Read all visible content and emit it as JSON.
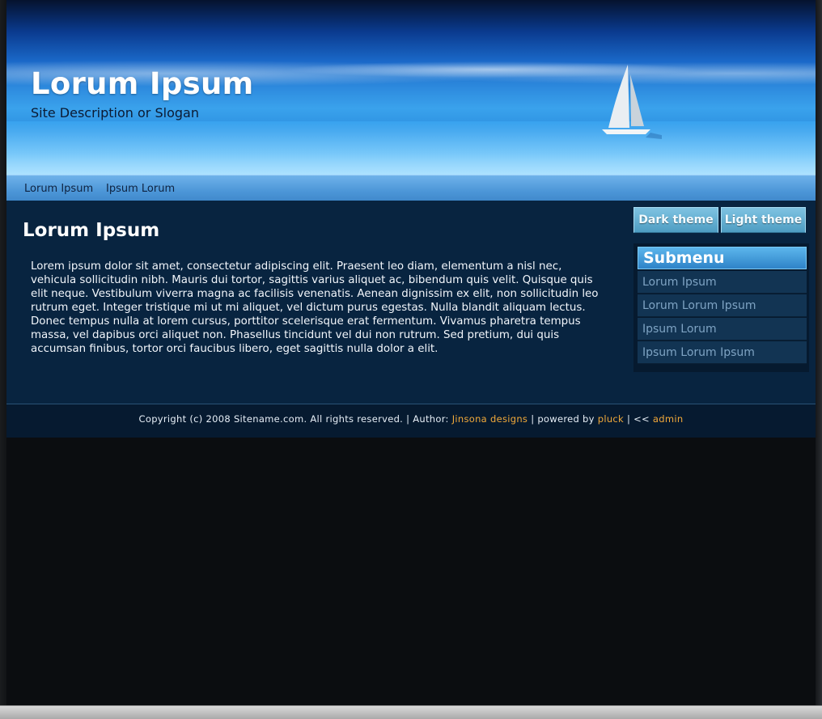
{
  "header": {
    "title": "Lorum Ipsum",
    "slogan": "Site Description or Slogan"
  },
  "nav": {
    "items": [
      "Lorum Ipsum",
      "Ipsum Lorum"
    ]
  },
  "main": {
    "title": "Lorum Ipsum",
    "body": "Lorem ipsum dolor sit amet, consectetur adipiscing elit. Praesent leo diam, elementum a nisl nec, vehicula sollicitudin nibh. Mauris dui tortor, sagittis varius aliquet ac, bibendum quis velit. Quisque quis elit neque. Vestibulum viverra magna ac facilisis venenatis. Aenean dignissim ex elit, non sollicitudin leo rutrum eget. Integer tristique mi ut mi aliquet, vel dictum purus egestas. Nulla blandit aliquam lectus. Donec tempus nulla at lorem cursus, porttitor scelerisque erat fermentum. Vivamus pharetra tempus massa, vel dapibus orci aliquet non. Phasellus tincidunt vel dui non rutrum. Sed pretium, dui quis accumsan finibus, tortor orci faucibus libero, eget sagittis nulla dolor a elit."
  },
  "themes": {
    "dark_label": "Dark theme",
    "light_label": "Light theme"
  },
  "submenu": {
    "heading": "Submenu",
    "items": [
      "Lorum Ipsum",
      "Lorum Lorum Ipsum",
      "Ipsum Lorum",
      "Ipsum Lorum Ipsum"
    ]
  },
  "footer": {
    "copyright": "Copyright (c) 2008 Sitename.com. All rights reserved.",
    "sep1": " | ",
    "author_prefix": "Author: ",
    "author_link": "Jinsona designs",
    "sep2": " | ",
    "powered_prefix": "powered by ",
    "powered_link": "pluck",
    "sep3": " | << ",
    "admin_link": "admin"
  },
  "colors": {
    "link_accent": "#f1a93a",
    "main_bg": "#082440",
    "nav_bg": "#4d97d8"
  }
}
